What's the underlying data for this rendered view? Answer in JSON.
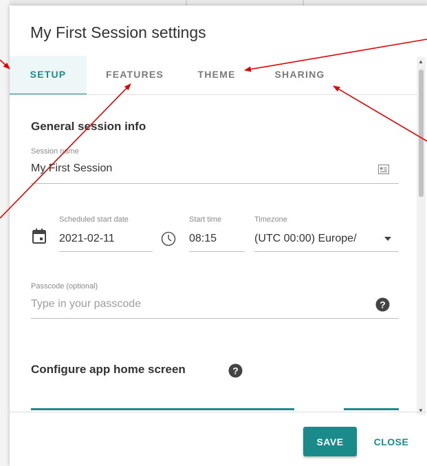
{
  "dialog": {
    "title": "My First Session settings"
  },
  "tabs": [
    {
      "label": "SETUP",
      "active": true
    },
    {
      "label": "FEATURES",
      "active": false
    },
    {
      "label": "THEME",
      "active": false
    },
    {
      "label": "SHARING",
      "active": false
    }
  ],
  "general": {
    "heading": "General session info",
    "session_name_label": "Session name",
    "session_name_value": "My First Session",
    "start_date_label": "Scheduled start date",
    "start_date_value": "2021-02-11",
    "start_time_label": "Start time",
    "start_time_value": "08:15",
    "timezone_label": "Timezone",
    "timezone_value": "(UTC 00:00) Europe/"
  },
  "passcode": {
    "label": "Passcode (optional)",
    "placeholder": "Type in your passcode"
  },
  "home_screen": {
    "heading": "Configure app home screen"
  },
  "footer": {
    "save_label": "SAVE",
    "close_label": "CLOSE"
  },
  "colors": {
    "accent": "#1b8a8a",
    "annotation_arrow": "#e00000"
  },
  "icons": [
    "calendar-icon",
    "clock-icon",
    "id-card-icon",
    "help-icon",
    "dropdown-arrow-icon"
  ]
}
